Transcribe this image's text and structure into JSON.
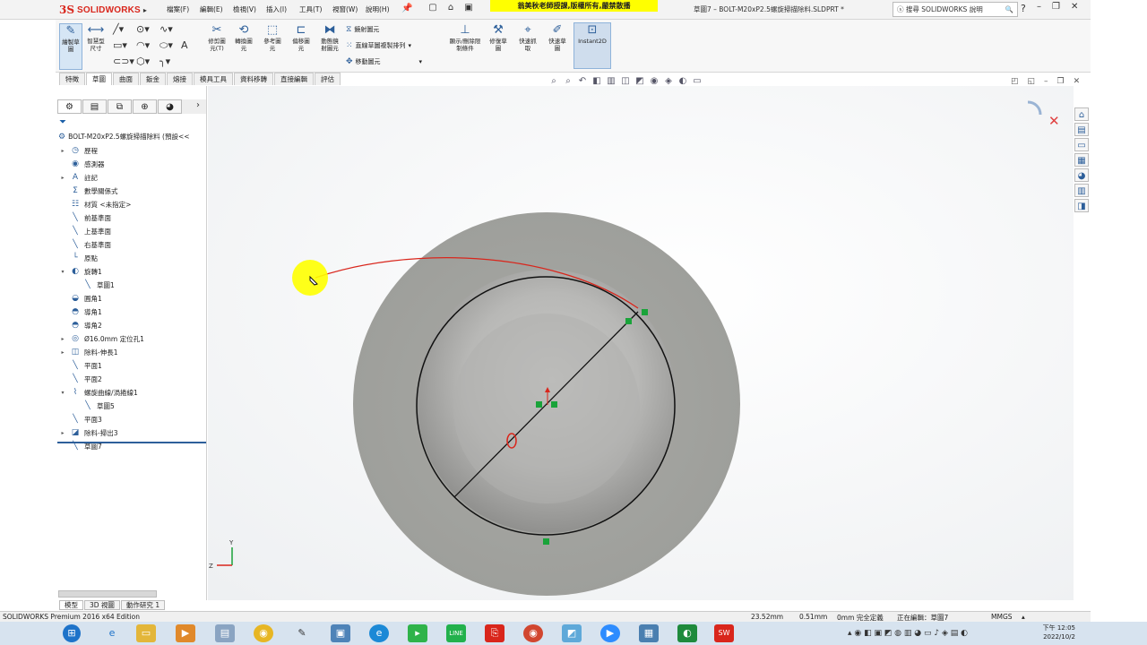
{
  "app": {
    "name": "SOLIDWORKS",
    "doc_title": "草圖7 – BOLT-M20xP2.5螺旋掃描除料.SLDPRT *"
  },
  "banner": "翁美秋老師授課,版權所有,嚴禁散播",
  "menu": [
    "檔案(F)",
    "編輯(E)",
    "檢視(V)",
    "插入(I)",
    "工具(T)",
    "視窗(W)",
    "說明(H)"
  ],
  "search_placeholder": "搜尋 SOLIDWORKS 說明",
  "ribbon": {
    "sketch": "繪製草圖",
    "smart_dim": "智慧型尺寸",
    "trim": "修剪圖元(T)",
    "convert": "轉換圖元",
    "offset_surface": "參考圖元",
    "offset": "偏移圖元",
    "dynamic_mirror": "動態鏡射圖元",
    "mirror": "鏡射圖元",
    "linear_pattern": "直線草圖複製排列",
    "move": "移動圖元",
    "relations": "顯示/刪除限制條件",
    "repair": "修復草圖",
    "quick_snaps": "快速抓取",
    "rapid_sketch": "快速草圖",
    "instant2d": "Instant2D"
  },
  "tabs": [
    "特徵",
    "草圖",
    "曲面",
    "鈑金",
    "熔接",
    "模具工具",
    "資料移轉",
    "直接編輯",
    "評估"
  ],
  "active_tab": "草圖",
  "tree": {
    "root": "BOLT-M20xP2.5螺旋掃描除料 (預設<<",
    "items": [
      {
        "label": "歷程",
        "icon": "history-icon",
        "exp": true,
        "indent": 0
      },
      {
        "label": "感測器",
        "icon": "sensor-icon",
        "exp": false,
        "indent": 0
      },
      {
        "label": "註記",
        "icon": "annotation-icon",
        "exp": true,
        "indent": 0
      },
      {
        "label": "數學關係式",
        "icon": "equation-icon",
        "exp": false,
        "indent": 0
      },
      {
        "label": "材質 <未指定>",
        "icon": "material-icon",
        "exp": false,
        "indent": 0
      },
      {
        "label": "前基準面",
        "icon": "plane-icon",
        "exp": false,
        "indent": 0
      },
      {
        "label": "上基準面",
        "icon": "plane-icon",
        "exp": false,
        "indent": 0
      },
      {
        "label": "右基準面",
        "icon": "plane-icon",
        "exp": false,
        "indent": 0
      },
      {
        "label": "原點",
        "icon": "origin-icon",
        "exp": false,
        "indent": 0
      },
      {
        "label": "旋轉1",
        "icon": "revolve-icon",
        "exp": true,
        "indent": 0
      },
      {
        "label": "草圖1",
        "icon": "sketch-icon",
        "exp": false,
        "indent": 1
      },
      {
        "label": "圓角1",
        "icon": "fillet-icon",
        "exp": false,
        "indent": 0
      },
      {
        "label": "導角1",
        "icon": "chamfer-icon",
        "exp": false,
        "indent": 0
      },
      {
        "label": "導角2",
        "icon": "chamfer-icon",
        "exp": false,
        "indent": 0
      },
      {
        "label": "Ø16.0mm 定位孔1",
        "icon": "hole-icon",
        "exp": true,
        "indent": 0
      },
      {
        "label": "除料-伸長1",
        "icon": "cut-extrude-icon",
        "exp": true,
        "indent": 0
      },
      {
        "label": "平面1",
        "icon": "plane-icon",
        "exp": false,
        "indent": 0
      },
      {
        "label": "平面2",
        "icon": "plane-icon",
        "exp": false,
        "indent": 0
      },
      {
        "label": "螺旋曲線/渦捲線1",
        "icon": "helix-icon",
        "exp": true,
        "indent": 0
      },
      {
        "label": "草圖5",
        "icon": "sketch-icon",
        "exp": false,
        "indent": 1
      },
      {
        "label": "平面3",
        "icon": "plane-icon",
        "exp": false,
        "indent": 0
      },
      {
        "label": "除料-掃出3",
        "icon": "cut-sweep-icon",
        "exp": true,
        "indent": 0
      },
      {
        "label": "草圖7",
        "icon": "sketch-icon",
        "exp": false,
        "indent": 0
      }
    ]
  },
  "bottom_tabs": [
    "模型",
    "3D 視圖",
    "動作研究 1"
  ],
  "status": {
    "edition": "SOLIDWORKS Premium 2016 x64 Edition",
    "x": "23.52mm",
    "y": "0.51mm",
    "z": "0mm 完全定義",
    "editing": "正在編輯：草圖7",
    "units": "MMGS"
  },
  "clock": {
    "time": "下午 12:05",
    "date": "2022/10/2"
  },
  "triad": {
    "y": "Y",
    "z": "Z"
  },
  "taskbar_icons": [
    "windows-start-icon",
    "ie-icon",
    "explorer-icon",
    "media-icon",
    "notepad-icon",
    "chrome-icon",
    "pencil-icon",
    "photo-icon",
    "edge-icon",
    "green-app-icon",
    "line-icon",
    "pdf-icon",
    "chrome-profile-icon",
    "paint-icon",
    "zoom-icon",
    "photos-icon",
    "green-app2-icon",
    "solidworks-2016-icon"
  ]
}
